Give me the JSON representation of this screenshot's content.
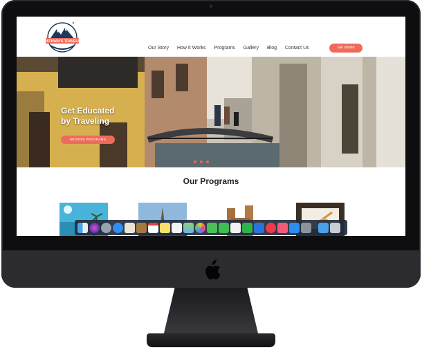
{
  "brand": {
    "name": "PATHWAYS TRAVELS",
    "colors": {
      "accent": "#ee6b5c",
      "bezel": "#0e0e10",
      "chin": "#2c2c30"
    }
  },
  "nav": {
    "items": [
      {
        "label": "Our Story"
      },
      {
        "label": "How It Works"
      },
      {
        "label": "Programs"
      },
      {
        "label": "Gallery"
      },
      {
        "label": "Blog"
      },
      {
        "label": "Contact Us"
      }
    ],
    "cta_label": "Get started"
  },
  "hero": {
    "title_line1": "Get Educated",
    "title_line2": "by Traveling",
    "button_label": "BROWSE PROGRAMS",
    "slide_count": 3
  },
  "programs": {
    "heading": "Our Programs",
    "cards": [
      {
        "icon": "beach-image"
      },
      {
        "icon": "cathedral-image"
      },
      {
        "icon": "castle-image"
      },
      {
        "icon": "writing-image"
      }
    ]
  },
  "dock": {
    "apps": [
      "finder-icon",
      "siri-icon",
      "launchpad-icon",
      "safari-icon",
      "photos-app-icon",
      "notes-brown-icon",
      "calendar-icon",
      "stickies-icon",
      "reminders-icon",
      "maps-icon",
      "photos-icon",
      "messages-icon",
      "facetime-icon",
      "keynote-icon",
      "numbers-icon",
      "keynote-blue-icon",
      "news-icon",
      "music-icon",
      "app-store-icon",
      "system-preferences-icon",
      "downloads-folder-icon",
      "trash-icon"
    ]
  }
}
